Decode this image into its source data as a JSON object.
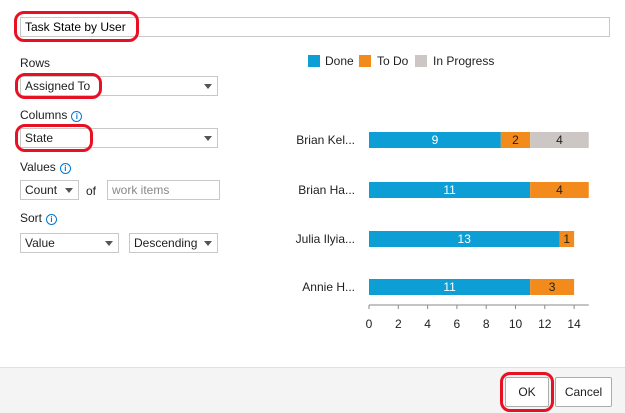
{
  "title_input": {
    "value": "Task State by User"
  },
  "rows": {
    "label": "Rows",
    "selected": "Assigned To"
  },
  "columns": {
    "label": "Columns",
    "selected": "State",
    "info_icon": "info-icon"
  },
  "values": {
    "label": "Values",
    "aggregate": "Count",
    "of": "of",
    "field_placeholder": "work items",
    "info_icon": "info-icon"
  },
  "sort": {
    "label": "Sort",
    "by": "Value",
    "order": "Descending",
    "info_icon": "info-icon"
  },
  "buttons": {
    "ok": "OK",
    "cancel": "Cancel"
  },
  "chart_data": {
    "type": "bar",
    "orientation": "horizontal",
    "stacked": true,
    "categories": [
      "Brian Kel...",
      "Brian Ha...",
      "Julia Ilyia...",
      "Annie H..."
    ],
    "series": [
      {
        "name": "Done",
        "color": "#0c9ed4",
        "values": [
          9,
          11,
          13,
          11
        ]
      },
      {
        "name": "To Do",
        "color": "#f28b1c",
        "values": [
          2,
          4,
          1,
          3
        ]
      },
      {
        "name": "In Progress",
        "color": "#ccc7c5",
        "values": [
          4,
          0,
          0,
          0
        ]
      }
    ],
    "xticks": [
      "0",
      "2",
      "4",
      "6",
      "8",
      "10",
      "12",
      "14"
    ],
    "xlim": [
      0,
      15
    ],
    "legend_position": "top"
  }
}
